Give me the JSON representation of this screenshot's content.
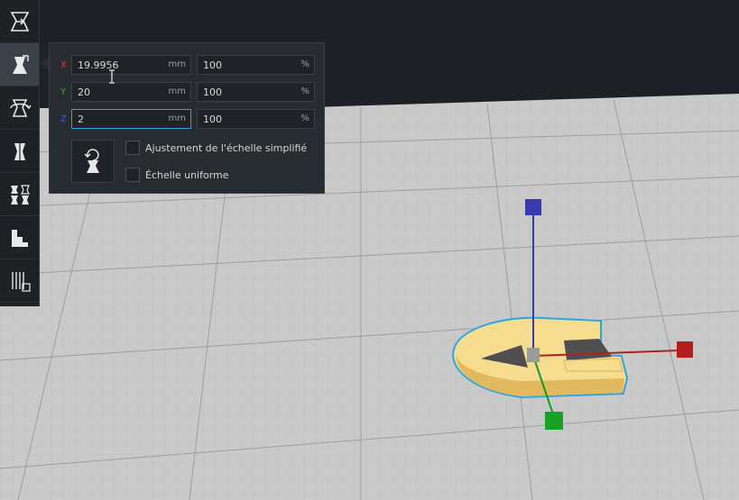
{
  "scale_panel": {
    "x": {
      "label": "X",
      "mm_value": "19.9956",
      "mm_unit": "mm",
      "percent_value": "100",
      "percent_unit": "%",
      "color": "#e0392b"
    },
    "y": {
      "label": "Y",
      "mm_value": "20",
      "mm_unit": "mm",
      "percent_value": "100",
      "percent_unit": "%",
      "color": "#3fae2a"
    },
    "z": {
      "label": "Z",
      "mm_value": "2",
      "mm_unit": "mm",
      "percent_value": "100",
      "percent_unit": "%",
      "color": "#4a5ad4"
    },
    "snap_scaling_label": "Ajustement de l'échelle simplifié",
    "uniform_scaling_label": "Échelle uniforme",
    "snap_scaling_checked": false,
    "uniform_scaling_checked": false
  },
  "toolbar": {
    "tools": [
      "move-tool",
      "scale-tool",
      "rotate-tool",
      "mirror-tool",
      "per-model-settings-tool",
      "support-blocker-tool",
      "support-tool"
    ],
    "active_tool": "scale-tool"
  },
  "colors": {
    "viewport_background": "#1d2126",
    "build_plate": "#c9c9c9",
    "toolbar": "#1e2226",
    "panel": "#272c31",
    "model_yellow": "#f6dc8f",
    "selection_outline": "#2aa7e0",
    "focus_accent": "#2da7df"
  }
}
